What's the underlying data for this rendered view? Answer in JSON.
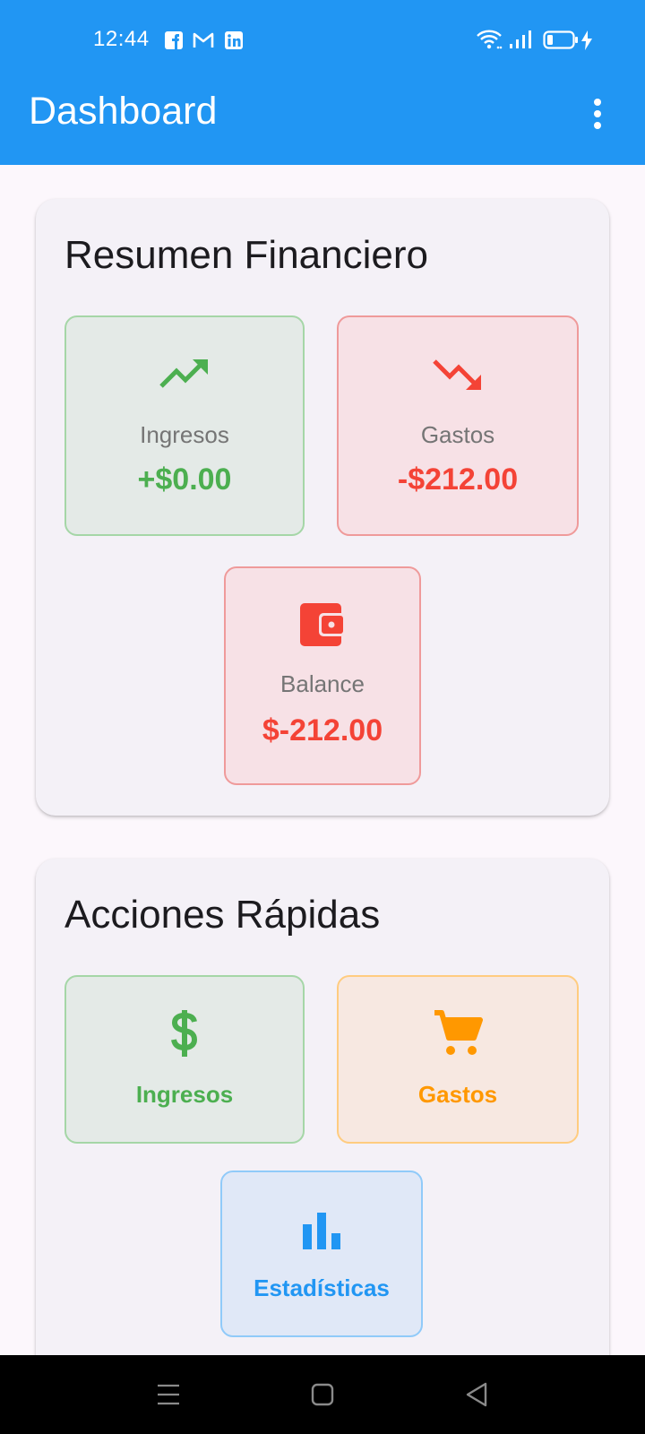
{
  "status_bar": {
    "time": "12:44",
    "notification_icons": [
      "facebook-icon",
      "gmail-icon",
      "linkedin-icon"
    ],
    "system_icons": [
      "wifi-icon",
      "signal-icon",
      "battery-icon",
      "charging-icon"
    ]
  },
  "app_bar": {
    "title": "Dashboard",
    "overflow_icon": "more-vert-icon"
  },
  "summary": {
    "title": "Resumen Financiero",
    "income": {
      "label": "Ingresos",
      "value": "+$0.00",
      "icon": "trending-up-icon",
      "color": "#4CAF50"
    },
    "expenses": {
      "label": "Gastos",
      "value": "-$212.00",
      "icon": "trending-down-icon",
      "color": "#F44336"
    },
    "balance": {
      "label": "Balance",
      "value": "$-212.00",
      "icon": "wallet-icon",
      "color": "#F44336"
    }
  },
  "quick_actions": {
    "title": "Acciones Rápidas",
    "income": {
      "label": "Ingresos",
      "icon": "dollar-icon",
      "color": "#4CAF50"
    },
    "expenses": {
      "label": "Gastos",
      "icon": "cart-icon",
      "color": "#FF9800"
    },
    "stats": {
      "label": "Estadísticas",
      "icon": "bar-chart-icon",
      "color": "#2196F3"
    }
  },
  "nav_bar": {
    "buttons": [
      "menu-icon",
      "home-icon",
      "back-icon"
    ]
  },
  "colors": {
    "primary": "#2196F3",
    "background": "#FCF7FC",
    "card": "#F4F1F7"
  }
}
